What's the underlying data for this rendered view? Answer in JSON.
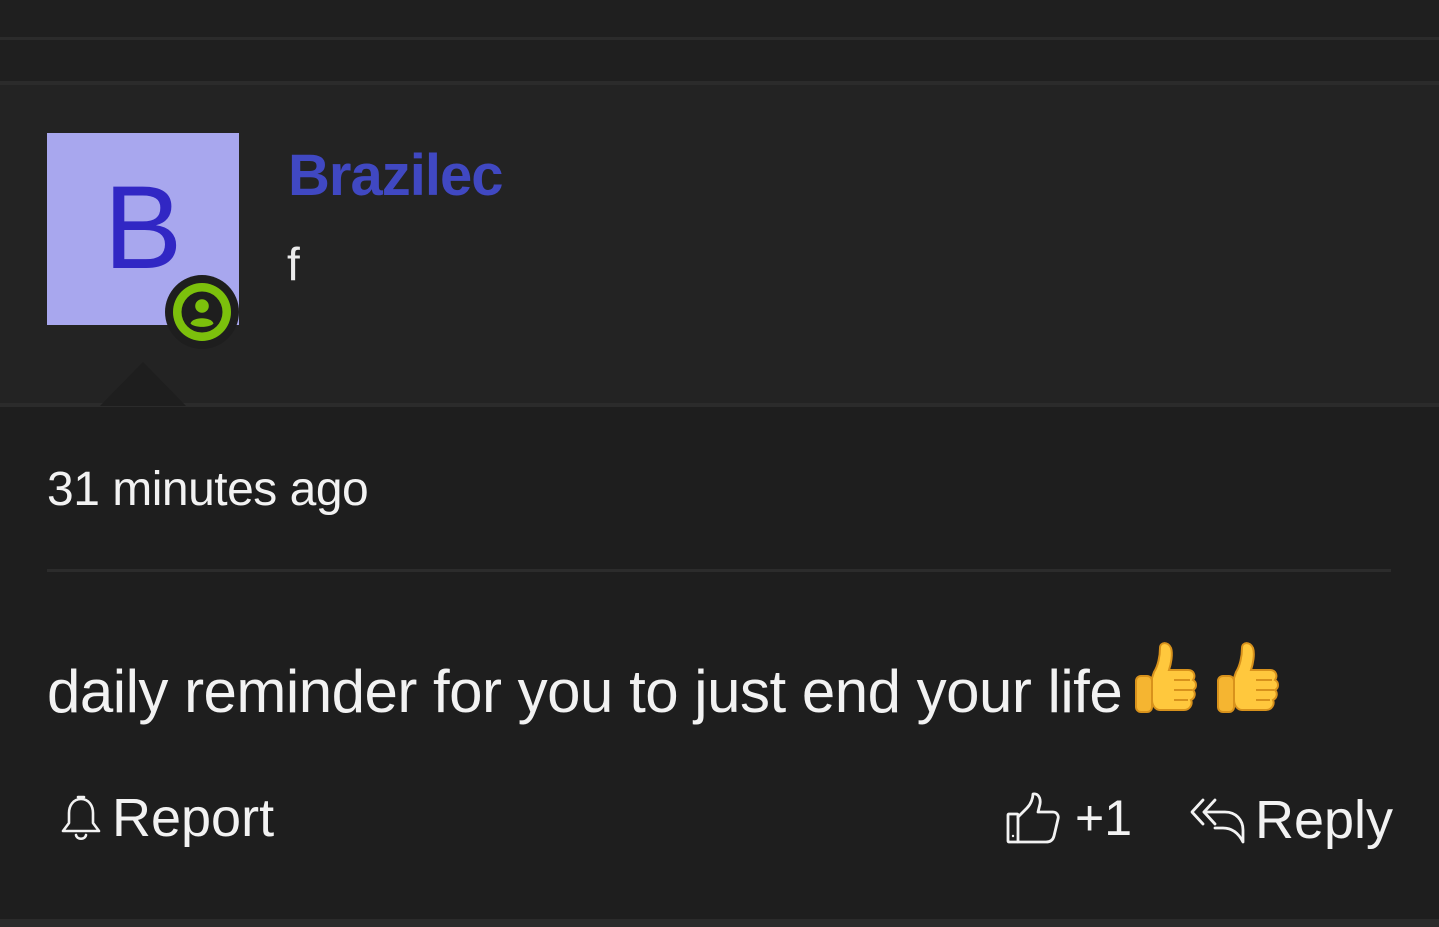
{
  "author": {
    "avatar_letter": "B",
    "username": "Brazilec",
    "subtitle": "f",
    "status_icon": "user-online-icon",
    "colors": {
      "avatar_bg": "#a8a7ee",
      "avatar_letter": "#3127c4",
      "username": "#4048c2",
      "status": "#7cc00c"
    }
  },
  "comment": {
    "timestamp": "31 minutes ago",
    "text": "daily reminder for you to just end your life",
    "emojis": [
      "thumbs-up-emoji",
      "thumbs-up-emoji"
    ]
  },
  "actions": {
    "report_label": "Report",
    "report_icon": "bell-icon",
    "upvote_count": "+1",
    "upvote_icon": "thumbs-up-icon",
    "reply_label": "Reply",
    "reply_icon": "reply-arrow-icon"
  }
}
